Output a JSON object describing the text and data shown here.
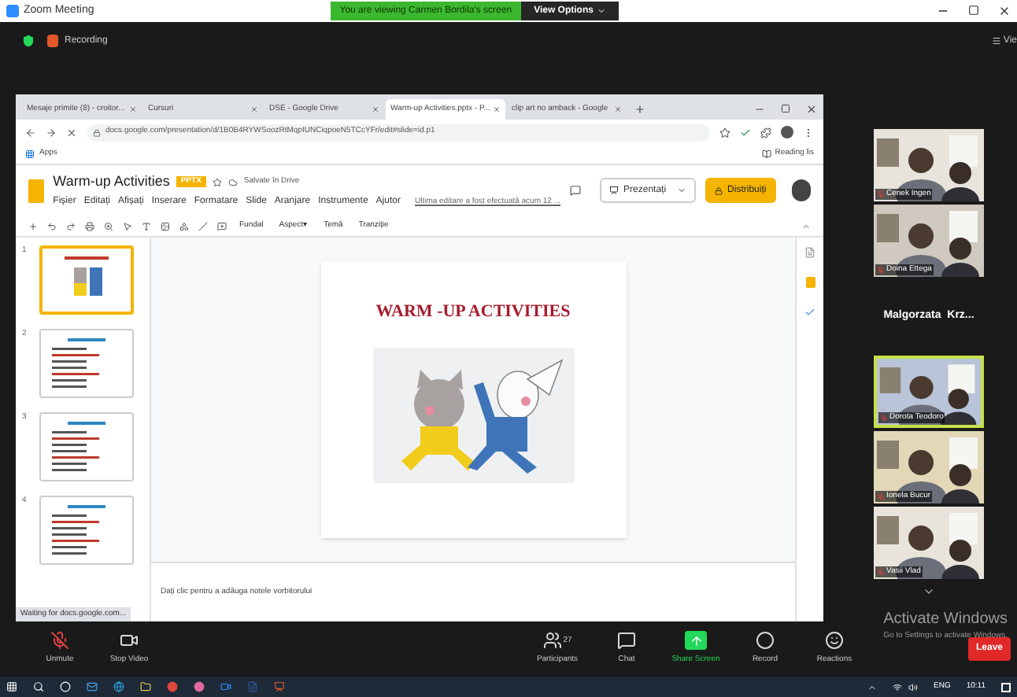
{
  "window": {
    "title": "Zoom Meeting"
  },
  "share_banner": {
    "text": "You are viewing Carmen Bordila's screen",
    "button": "View Options"
  },
  "meeting_bar": {
    "recording": "Recording",
    "view": "Vie"
  },
  "browser": {
    "tabs": [
      {
        "title": "Mesaje primite (8) - croitor...",
        "selected": false
      },
      {
        "title": "Cursuri",
        "selected": false
      },
      {
        "title": "DSE - Google Drive",
        "selected": false
      },
      {
        "title": "Warm-up Activities.pptx - P...",
        "selected": true
      },
      {
        "title": "clip art no amback - Google",
        "selected": false
      }
    ],
    "address": "docs.google.com/presentation/d/1B0B4RYWSoozRtMqpIUNCiqpoeN5TCcYFr/edit#slide=id.p1",
    "bookmark": "Apps",
    "reading_list": "Reading lis"
  },
  "document": {
    "title": "Warm-up Activities",
    "badge": "PPTX",
    "saved": "Salvate în Drive",
    "menus": [
      "Fișier",
      "Editați",
      "Afișați",
      "Inserare",
      "Formatare",
      "Slide",
      "Aranjare",
      "Instrumente",
      "Ajutor"
    ],
    "last_edit": "Ultima editare a fost efectuată acum 12 ...",
    "present": "Prezentați",
    "share": "Distribuiți",
    "toolbar": [
      "Fundal",
      "Aspect▾",
      "Temă",
      "Tranziție"
    ],
    "slides": [
      {
        "number": "1",
        "selected": true
      },
      {
        "number": "2",
        "selected": false
      },
      {
        "number": "3",
        "selected": false
      },
      {
        "number": "4",
        "selected": false
      }
    ],
    "slide_title": "WARM -UP ACTIVITIES",
    "notes_placeholder": "Dați clic pentru a adăuga notele vorbitorului",
    "status": "Waiting for docs.google.com..."
  },
  "participants": [
    {
      "name": "Cenek Ingen",
      "kind": "video",
      "selected": false
    },
    {
      "name": "Doina Ettega",
      "kind": "video",
      "selected": false
    },
    {
      "name": "Malgorzata  Krz...",
      "kind": "name",
      "selected": false
    },
    {
      "name": "Dorota Teodoro",
      "kind": "video",
      "selected": true
    },
    {
      "name": "Ionela Bucur",
      "kind": "video",
      "selected": false
    },
    {
      "name": "Vasii Vlad",
      "kind": "video",
      "selected": false
    }
  ],
  "activation": {
    "title": "Activate Windows",
    "text": "Go to Settings to activate Windows."
  },
  "controls": [
    {
      "label": "Unmute",
      "kind": "mic"
    },
    {
      "label": "Stop Video",
      "kind": "video"
    },
    {
      "label": "Participants",
      "kind": "participants",
      "count": "27"
    },
    {
      "label": "Chat",
      "kind": "chat"
    },
    {
      "label": "Share Screen",
      "kind": "share"
    },
    {
      "label": "Record",
      "kind": "record"
    },
    {
      "label": "Reactions",
      "kind": "reactions"
    }
  ],
  "leave": "Leave",
  "taskbar": {
    "language": "ENG",
    "time": "10:11"
  }
}
